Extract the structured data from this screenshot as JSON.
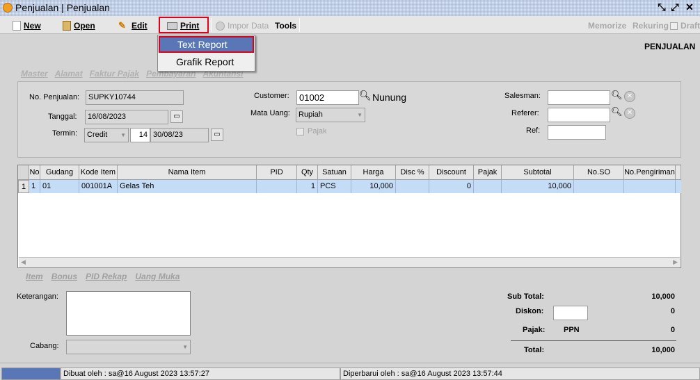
{
  "window": {
    "title": "Penjualan | Penjualan"
  },
  "toolbar": {
    "new": "New",
    "open": "Open",
    "edit": "Edit",
    "print": "Print",
    "import": "Impor Data",
    "tools": "Tools",
    "memorize": "Memorize",
    "rekuring": "Rekuring",
    "draft": "Draft"
  },
  "menu": {
    "text_report": "Text Report",
    "grafik_report": "Grafik Report"
  },
  "page": {
    "heading": "PENJUALAN"
  },
  "tabs": [
    "Master",
    "Alamat",
    "Faktur Pajak",
    "Pembayaran",
    "Akuntansi"
  ],
  "form": {
    "no_penjualan_label": "No. Penjualan:",
    "no_penjualan": "SUPKY10744",
    "tanggal_label": "Tanggal:",
    "tanggal": "16/08/2023",
    "termin_label": "Termin:",
    "termin": "Credit",
    "termin_days": "14",
    "termin_date": "30/08/23",
    "customer_label": "Customer:",
    "customer_code": "01002",
    "customer_name": "Nunung",
    "mata_uang_label": "Mata Uang:",
    "mata_uang": "Rupiah",
    "pajak_label": "Pajak",
    "salesman_label": "Salesman:",
    "referer_label": "Referer:",
    "ref_label": "Ref:"
  },
  "grid": {
    "headers": [
      "No",
      "Gudang",
      "Kode Item",
      "Nama Item",
      "PID",
      "Qty",
      "Satuan",
      "Harga",
      "Disc %",
      "Discount",
      "Pajak",
      "Subtotal",
      "No.SO",
      "No.Pengiriman"
    ],
    "rows": [
      {
        "row_no": "1",
        "no": "1",
        "gudang": "01",
        "kode": "001001A",
        "nama": "Gelas Teh",
        "pid": "",
        "qty": "1",
        "satuan": "PCS",
        "harga": "10,000",
        "disc": "",
        "discount": "0",
        "pajak": "",
        "subtotal": "10,000",
        "so": "",
        "pengiriman": ""
      }
    ]
  },
  "bottom_tabs": [
    "Item",
    "Bonus",
    "PID Rekap",
    "Uang Muka"
  ],
  "footer": {
    "keterangan_label": "Keterangan:",
    "cabang_label": "Cabang:",
    "subtotal_label": "Sub Total:",
    "subtotal": "10,000",
    "diskon_label": "Diskon:",
    "diskon": "0",
    "pajak_label": "Pajak:",
    "pajak_type": "PPN",
    "pajak": "0",
    "total_label": "Total:",
    "total": "10,000"
  },
  "status": {
    "created": "Dibuat oleh : sa@16 August 2023  13:57:27",
    "updated": "Diperbarui oleh : sa@16 August 2023  13:57:44"
  }
}
